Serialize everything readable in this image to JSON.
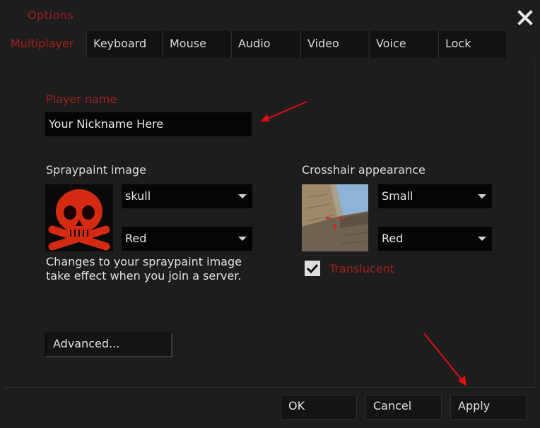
{
  "window": {
    "title": "Options"
  },
  "tabs": [
    {
      "label": "Multiplayer",
      "active": true
    },
    {
      "label": "Keyboard"
    },
    {
      "label": "Mouse"
    },
    {
      "label": "Audio"
    },
    {
      "label": "Video"
    },
    {
      "label": "Voice"
    },
    {
      "label": "Lock"
    }
  ],
  "player": {
    "label": "Player name",
    "value": "Your Nickname Here"
  },
  "spray": {
    "label": "Spraypaint image",
    "image_dropdown": "skull",
    "color_dropdown": "Red",
    "note_line1": "Changes to your spraypaint image",
    "note_line2": "take effect when you join a server."
  },
  "crosshair": {
    "label": "Crosshair appearance",
    "size_dropdown": "Small",
    "color_dropdown": "Red",
    "translucent_label": "Translucent",
    "translucent_checked": true
  },
  "buttons": {
    "advanced": "Advanced...",
    "ok": "OK",
    "cancel": "Cancel",
    "apply": "Apply"
  },
  "colors": {
    "accent_red": "#a02020",
    "annotation_arrow": "#e01010"
  },
  "annotations": [
    {
      "icon": "red-arrow-icon"
    },
    {
      "icon": "red-arrow-icon"
    }
  ]
}
